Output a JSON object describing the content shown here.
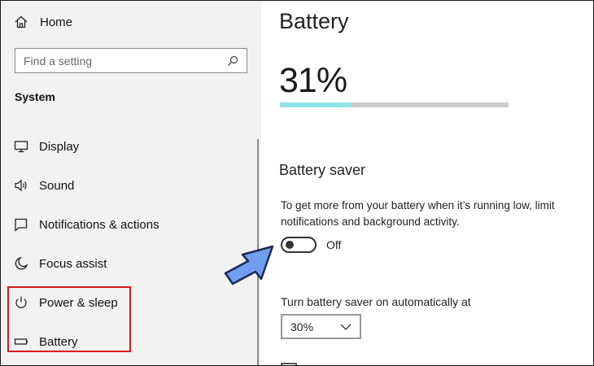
{
  "sidebar": {
    "home_label": "Home",
    "search_placeholder": "Find a setting",
    "section_title": "System",
    "items": [
      {
        "label": "Display",
        "icon": "monitor-icon"
      },
      {
        "label": "Sound",
        "icon": "speaker-icon"
      },
      {
        "label": "Notifications & actions",
        "icon": "notification-icon"
      },
      {
        "label": "Focus assist",
        "icon": "moon-icon"
      },
      {
        "label": "Power & sleep",
        "icon": "power-icon"
      },
      {
        "label": "Battery",
        "icon": "battery-icon"
      }
    ],
    "highlight_color": "#d7181e"
  },
  "main": {
    "title": "Battery",
    "percent_text": "31%",
    "battery_level": 0.31,
    "bar_color": "#8ee2e2",
    "battery_saver": {
      "heading": "Battery saver",
      "description_line1": "To get more from your battery when it’s running low, limit",
      "description_line2": "notifications and background activity.",
      "toggle_state_label": "Off",
      "toggle_on": false,
      "auto_label": "Turn battery saver on automatically at",
      "auto_value": "30%"
    }
  },
  "annotation": {
    "arrow_color": "#6f9fee",
    "arrow_icon": "pointer-arrow-icon"
  }
}
